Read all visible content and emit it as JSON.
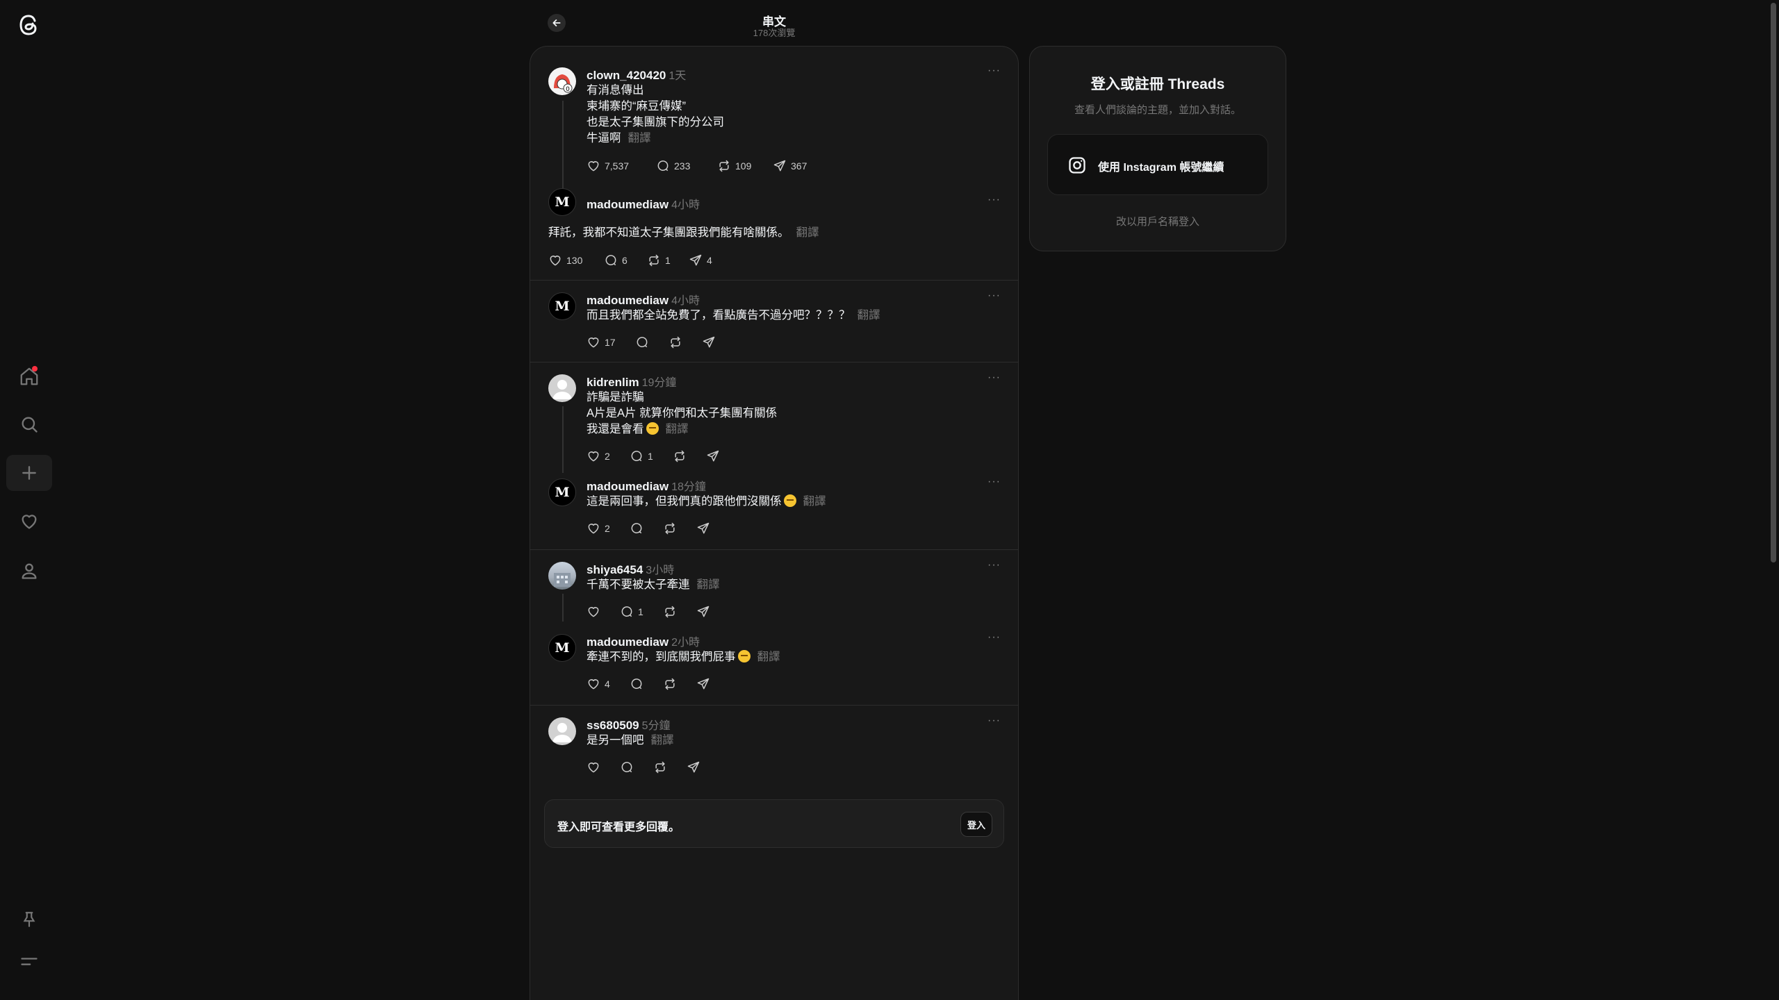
{
  "nav": {
    "logo_icon": "threads-logo-icon",
    "items": [
      {
        "name": "home",
        "icon": "home-icon",
        "badge": true
      },
      {
        "name": "search",
        "icon": "search-icon"
      },
      {
        "name": "create",
        "icon": "plus-icon"
      },
      {
        "name": "activity",
        "icon": "heart-icon"
      },
      {
        "name": "profile",
        "icon": "person-icon"
      }
    ],
    "bottom": [
      {
        "name": "pin",
        "icon": "pin-icon"
      },
      {
        "name": "menu",
        "icon": "menu-icon"
      }
    ]
  },
  "header": {
    "title": "串文",
    "views": "178次瀏覽"
  },
  "posts": [
    {
      "id": "p1",
      "user": "clown_420420",
      "time": "1天",
      "lines": [
        "有消息傳出",
        "柬埔寨的“麻豆傳媒”",
        "也是太子集團旗下的分公司",
        "牛逼啊"
      ],
      "translate": "翻譯",
      "likes": "7,537",
      "replies": "233",
      "reposts": "109",
      "shares": "367"
    },
    {
      "id": "p2",
      "user": "madoumediaw",
      "time": "4小時",
      "lines": [
        "拜託，我都不知道太子集團跟我們能有啥關係。"
      ],
      "translate": "翻譯",
      "likes": "130",
      "replies": "6",
      "reposts": "1",
      "shares": "4"
    },
    {
      "id": "p3",
      "user": "madoumediaw",
      "time": "4小時",
      "lines": [
        "而且我們都全站免費了，看點廣告不過分吧？？？？"
      ],
      "translate": "翻譯",
      "likes": "17"
    },
    {
      "id": "p4",
      "user": "kidrenlim",
      "time": "19分鐘",
      "lines": [
        "詐騙是詐騙",
        "A片是A片 就算你們和太子集團有關係",
        "我還是會看"
      ],
      "translate": "翻譯",
      "likes": "2",
      "replies": "1"
    },
    {
      "id": "p5",
      "user": "madoumediaw",
      "time": "18分鐘",
      "lines": [
        "這是兩回事，但我們真的跟他們沒關係"
      ],
      "translate": "翻譯",
      "likes": "2"
    },
    {
      "id": "p6",
      "user": "shiya6454",
      "time": "3小時",
      "lines": [
        "千萬不要被太子牽連"
      ],
      "translate": "翻譯",
      "replies": "1"
    },
    {
      "id": "p7",
      "user": "madoumediaw",
      "time": "2小時",
      "lines": [
        "牽連不到的，到底關我們屁事"
      ],
      "translate": "翻譯",
      "likes": "4"
    },
    {
      "id": "p8",
      "user": "ss680509",
      "time": "5分鐘",
      "lines": [
        "是另一個吧"
      ],
      "translate": "翻譯"
    }
  ],
  "login_bar": {
    "text": "登入即可查看更多回覆。",
    "button": "登入"
  },
  "card": {
    "title": "登入或註冊 Threads",
    "subtitle": "查看人們談論的主題，並加入對話。",
    "instagram_button": "使用 Instagram 帳號繼續",
    "alt_login": "改以用戶名稱登入"
  },
  "colors": {
    "background": "#101010",
    "panel": "#181818",
    "border": "#2d2d2d",
    "muted_text": "#777777",
    "notification_dot": "#ff3040"
  }
}
